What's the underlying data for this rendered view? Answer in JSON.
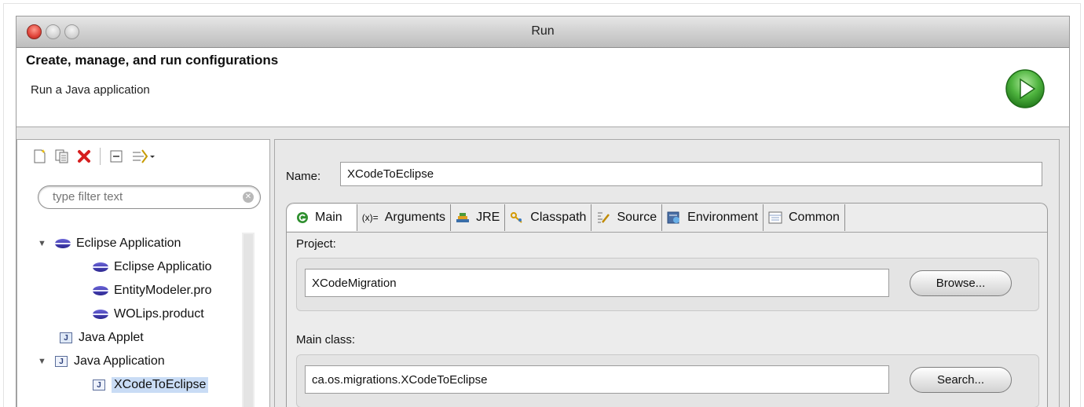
{
  "window": {
    "title": "Run"
  },
  "header": {
    "title": "Create, manage, and run configurations",
    "subtitle": "Run a Java application",
    "icon": "run-play-icon"
  },
  "toolbar": {
    "icons": [
      "new-config-icon",
      "duplicate-icon",
      "delete-icon",
      "collapse-all-icon",
      "filter-menu-icon"
    ]
  },
  "filter": {
    "placeholder": "type filter text",
    "value": ""
  },
  "tree": {
    "items": [
      {
        "label": "Eclipse Application",
        "icon": "eclipse-app-icon",
        "expanded": true
      },
      {
        "label": "Eclipse Applicatio",
        "icon": "eclipse-app-icon"
      },
      {
        "label": "EntityModeler.pro",
        "icon": "eclipse-app-icon"
      },
      {
        "label": "WOLips.product",
        "icon": "eclipse-app-icon"
      },
      {
        "label": "Java Applet",
        "icon": "java-applet-icon"
      },
      {
        "label": "Java Application",
        "icon": "java-app-icon",
        "expanded": true
      },
      {
        "label": "XCodeToEclipse",
        "icon": "java-app-icon",
        "selected": true
      }
    ]
  },
  "config": {
    "name_label": "Name:",
    "name_value": "XCodeToEclipse",
    "tabs": [
      {
        "label": "Main",
        "icon": "main-tab-icon",
        "active": true
      },
      {
        "label": "Arguments",
        "icon": "arguments-icon",
        "icon_text": "(x)="
      },
      {
        "label": "JRE",
        "icon": "jre-icon"
      },
      {
        "label": "Classpath",
        "icon": "classpath-icon"
      },
      {
        "label": "Source",
        "icon": "source-icon"
      },
      {
        "label": "Environment",
        "icon": "environment-icon"
      },
      {
        "label": "Common",
        "icon": "common-icon"
      }
    ],
    "project_label": "Project:",
    "project_value": "XCodeMigration",
    "browse_label": "Browse...",
    "main_class_label": "Main class:",
    "main_class_value": "ca.os.migrations.XCodeToEclipse",
    "search_label": "Search..."
  },
  "colors": {
    "selection": "#c9dcf5",
    "close_button": "#e0443a",
    "run_green": "#3aa535"
  }
}
